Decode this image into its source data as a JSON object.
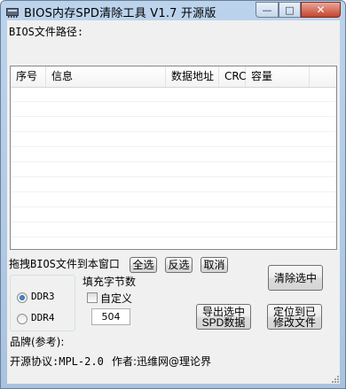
{
  "window": {
    "title": "BIOS内存SPD清除工具 V1.7  开源版",
    "minimize_glyph": "—",
    "maximize_glyph": "□",
    "close_glyph": "✕"
  },
  "path": {
    "label": "BIOS文件路径:",
    "value": ""
  },
  "table": {
    "columns": [
      "序号",
      "信息",
      "数据地址",
      "CRC",
      "容量"
    ],
    "rows": []
  },
  "drop_hint": "拖拽BIOS文件到本窗口",
  "buttons": {
    "select_all": "全选",
    "invert": "反选",
    "cancel": "取消",
    "clear_selected": "清除选中",
    "export_line1": "导出选中",
    "export_line2": "SPD数据",
    "locate_line1": "定位到已",
    "locate_line2": "修改文件"
  },
  "ddr": {
    "options": [
      "DDR3",
      "DDR4"
    ],
    "selected": "DDR3"
  },
  "fill": {
    "label": "填充字节数",
    "custom_label": "自定义",
    "custom_checked": false,
    "value": "504"
  },
  "brand_label": "品牌(参考):",
  "footer": {
    "license": "开源协议:MPL-2.0",
    "author": "作者:迅维网@理论界"
  }
}
